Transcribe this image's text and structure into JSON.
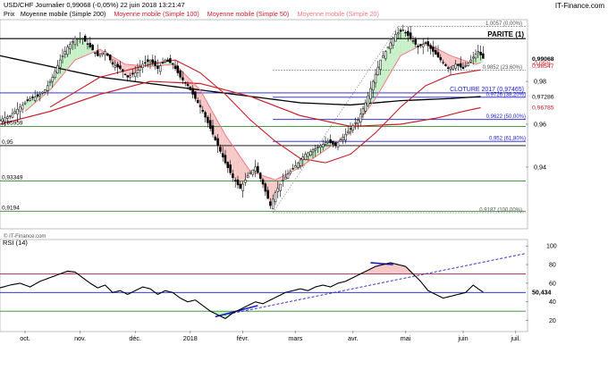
{
  "header": {
    "title": "USD/CHF   Journalier   0,99068 (-0,05%)   22 juin 2018 13:21:47",
    "brand": "IT-Finance.com"
  },
  "legend": [
    {
      "label": "Prix",
      "color": "#000000"
    },
    {
      "label": "Moyenne mobile (Simple 200)",
      "color": "#000000"
    },
    {
      "label": "Moyenne mobile (Simple 100)",
      "color": "#c81e28"
    },
    {
      "label": "Moyenne mobile (Simple 50)",
      "color": "#c81e28"
    },
    {
      "label": "Moyenne mobile (Simple 20)",
      "color": "#f07a84"
    }
  ],
  "watermark": "© IT-Finance.com",
  "colors": {
    "candle": "#000000",
    "sma200": "#000000",
    "sma100": "#c81e28",
    "sma50": "#c81e28",
    "sma20": "#f07a84",
    "horizontal": "#000000",
    "support_green": "#2e8b2e",
    "fib_blue": "#1a1acc",
    "rsi_line": "#000000",
    "rsi_upper": "#b0204a",
    "rsi_mid": "#1a1acc",
    "rsi_lower": "#2e8b2e",
    "fill_green": "#c8f0c8",
    "fill_red": "#f6c8c8",
    "trend_blue": "#1a1acc"
  },
  "chart_data": [
    {
      "type": "candlestick",
      "name": "USD/CHF Journalier",
      "ylim": [
        0.912,
        1.008
      ],
      "xlim": [
        0,
        210
      ],
      "x_ticks": [
        {
          "x": 10,
          "label": "oct."
        },
        {
          "x": 32,
          "label": "nov."
        },
        {
          "x": 54,
          "label": "déc."
        },
        {
          "x": 76,
          "label": "2018"
        },
        {
          "x": 97,
          "label": "févr."
        },
        {
          "x": 118,
          "label": "mars"
        },
        {
          "x": 141,
          "label": "avr."
        },
        {
          "x": 162,
          "label": "mai"
        },
        {
          "x": 185,
          "label": "juin"
        },
        {
          "x": 206,
          "label": "juil."
        }
      ],
      "y_ticks": [
        0.94,
        0.96,
        0.98
      ],
      "price_path": [
        [
          0,
          0.962
        ],
        [
          4,
          0.964
        ],
        [
          8,
          0.968
        ],
        [
          12,
          0.972
        ],
        [
          15,
          0.973
        ],
        [
          18,
          0.976
        ],
        [
          21,
          0.982
        ],
        [
          24,
          0.99
        ],
        [
          27,
          0.996
        ],
        [
          30,
          1.0
        ],
        [
          33,
          1.0
        ],
        [
          36,
          0.996
        ],
        [
          39,
          0.992
        ],
        [
          42,
          0.994
        ],
        [
          45,
          0.988
        ],
        [
          48,
          0.986
        ],
        [
          51,
          0.982
        ],
        [
          54,
          0.984
        ],
        [
          57,
          0.988
        ],
        [
          60,
          0.99
        ],
        [
          63,
          0.986
        ],
        [
          66,
          0.99
        ],
        [
          69,
          0.988
        ],
        [
          72,
          0.982
        ],
        [
          75,
          0.978
        ],
        [
          78,
          0.972
        ],
        [
          81,
          0.966
        ],
        [
          84,
          0.958
        ],
        [
          87,
          0.95
        ],
        [
          90,
          0.942
        ],
        [
          93,
          0.935
        ],
        [
          96,
          0.93
        ],
        [
          99,
          0.936
        ],
        [
          102,
          0.94
        ],
        [
          105,
          0.932
        ],
        [
          108,
          0.922
        ],
        [
          110,
          0.928
        ],
        [
          113,
          0.934
        ],
        [
          116,
          0.938
        ],
        [
          119,
          0.942
        ],
        [
          122,
          0.946
        ],
        [
          125,
          0.948
        ],
        [
          128,
          0.95
        ],
        [
          131,
          0.952
        ],
        [
          134,
          0.95
        ],
        [
          137,
          0.954
        ],
        [
          140,
          0.958
        ],
        [
          143,
          0.962
        ],
        [
          146,
          0.97
        ],
        [
          149,
          0.98
        ],
        [
          152,
          0.99
        ],
        [
          155,
          0.996
        ],
        [
          158,
          1.002
        ],
        [
          161,
          1.004
        ],
        [
          164,
          1.0
        ],
        [
          167,
          0.996
        ],
        [
          170,
          0.998
        ],
        [
          173,
          0.994
        ],
        [
          176,
          0.99
        ],
        [
          179,
          0.986
        ],
        [
          182,
          0.988
        ],
        [
          185,
          0.986
        ],
        [
          188,
          0.99
        ],
        [
          191,
          0.994
        ],
        [
          193,
          0.9907
        ]
      ],
      "sma20": [
        [
          10,
          0.966
        ],
        [
          20,
          0.976
        ],
        [
          30,
          0.99
        ],
        [
          40,
          0.995
        ],
        [
          50,
          0.988
        ],
        [
          60,
          0.987
        ],
        [
          70,
          0.988
        ],
        [
          80,
          0.976
        ],
        [
          90,
          0.955
        ],
        [
          100,
          0.938
        ],
        [
          110,
          0.934
        ],
        [
          120,
          0.94
        ],
        [
          130,
          0.948
        ],
        [
          140,
          0.956
        ],
        [
          150,
          0.972
        ],
        [
          160,
          0.992
        ],
        [
          170,
          0.998
        ],
        [
          180,
          0.992
        ],
        [
          190,
          0.988
        ],
        [
          193,
          0.989
        ]
      ],
      "sma50": [
        [
          20,
          0.968
        ],
        [
          40,
          0.982
        ],
        [
          60,
          0.988
        ],
        [
          70,
          0.99
        ],
        [
          80,
          0.984
        ],
        [
          90,
          0.974
        ],
        [
          100,
          0.962
        ],
        [
          110,
          0.952
        ],
        [
          120,
          0.944
        ],
        [
          130,
          0.942
        ],
        [
          140,
          0.946
        ],
        [
          150,
          0.956
        ],
        [
          160,
          0.968
        ],
        [
          170,
          0.978
        ],
        [
          180,
          0.983
        ],
        [
          190,
          0.985
        ],
        [
          193,
          0.9855
        ]
      ],
      "sma100": [
        [
          0,
          0.96
        ],
        [
          20,
          0.966
        ],
        [
          40,
          0.974
        ],
        [
          60,
          0.98
        ],
        [
          80,
          0.979
        ],
        [
          100,
          0.973
        ],
        [
          120,
          0.964
        ],
        [
          140,
          0.959
        ],
        [
          160,
          0.96
        ],
        [
          175,
          0.963
        ],
        [
          185,
          0.966
        ],
        [
          193,
          0.968
        ]
      ],
      "sma200": [
        [
          0,
          0.992
        ],
        [
          20,
          0.987
        ],
        [
          40,
          0.982
        ],
        [
          60,
          0.979
        ],
        [
          80,
          0.976
        ],
        [
          100,
          0.973
        ],
        [
          120,
          0.97
        ],
        [
          140,
          0.969
        ],
        [
          160,
          0.971
        ],
        [
          180,
          0.972
        ],
        [
          193,
          0.973
        ]
      ],
      "horizontal_levels": [
        {
          "value": 1.0,
          "label": "PARITE (1)",
          "color": "horizontal",
          "x_from": 0,
          "x_to": 210
        },
        {
          "value": 0.97465,
          "label": "CLOTURE 2017 (0,97465)",
          "color": "fib_blue",
          "x_from": 0,
          "x_to": 210
        },
        {
          "value": 0.9622,
          "label": "0,9622 (50,00%)",
          "color": "fib_blue",
          "x_from": 109,
          "x_to": 210
        },
        {
          "value": 0.95,
          "label": "0,95",
          "color": "horizontal",
          "x_from": 0,
          "x_to": 210
        },
        {
          "value": 0.952,
          "label": "0,952 (61,80%)",
          "color": "fib_blue",
          "x_from": 109,
          "x_to": 210
        },
        {
          "value": 0.9726,
          "label": "0,9726 (38,20%)",
          "color": "fib_blue",
          "x_from": 109,
          "x_to": 210
        },
        {
          "value": 0.959,
          "label": "0,95959",
          "color": "support_green",
          "x_from": 0,
          "x_to": 210
        },
        {
          "value": 0.93349,
          "label": "0,93349",
          "color": "support_green",
          "x_from": 0,
          "x_to": 210
        },
        {
          "value": 0.9194,
          "label": "0,9194",
          "color": "support_green",
          "x_from": 0,
          "x_to": 210
        }
      ],
      "dotted_levels": [
        {
          "value": 1.0057,
          "label": "1,0057 (0,00%)",
          "x_from": 159,
          "x_to": 210
        },
        {
          "value": 0.9852,
          "label": "0,9852 (23,60%)",
          "x_from": 109,
          "x_to": 210
        },
        {
          "value": 0.9187,
          "label": "0,9187 (100,00%)",
          "x_from": 109,
          "x_to": 210
        }
      ],
      "price_tags": [
        {
          "value": 0.99068,
          "label": "0,99068",
          "color": "#000000"
        },
        {
          "value": 0.9886,
          "label": "-0,05%",
          "color": "#c81e28"
        },
        {
          "value": 0.9874,
          "label": "0,98547",
          "color": "#c81e28"
        },
        {
          "value": 0.97286,
          "label": "0,97286",
          "color": "#000000"
        },
        {
          "value": 0.96785,
          "label": "0,96785",
          "color": "#c81e28"
        }
      ]
    },
    {
      "type": "line",
      "name": "RSI (14)",
      "ylim": [
        10,
        105
      ],
      "y_ticks": [
        20,
        40,
        60,
        80,
        100
      ],
      "levels": [
        {
          "value": 70,
          "color": "rsi_upper"
        },
        {
          "value": 50,
          "color": "rsi_mid"
        },
        {
          "value": 30,
          "color": "rsi_lower"
        }
      ],
      "last_value_label": "50,434",
      "last_value": 50.434,
      "values": [
        [
          0,
          55
        ],
        [
          4,
          58
        ],
        [
          8,
          60
        ],
        [
          12,
          56
        ],
        [
          16,
          62
        ],
        [
          20,
          66
        ],
        [
          24,
          70
        ],
        [
          27,
          73
        ],
        [
          30,
          72
        ],
        [
          33,
          66
        ],
        [
          36,
          60
        ],
        [
          39,
          55
        ],
        [
          42,
          58
        ],
        [
          45,
          50
        ],
        [
          48,
          52
        ],
        [
          51,
          48
        ],
        [
          54,
          52
        ],
        [
          57,
          56
        ],
        [
          60,
          54
        ],
        [
          63,
          48
        ],
        [
          66,
          52
        ],
        [
          69,
          50
        ],
        [
          72,
          44
        ],
        [
          75,
          40
        ],
        [
          78,
          42
        ],
        [
          81,
          36
        ],
        [
          84,
          30
        ],
        [
          87,
          26
        ],
        [
          90,
          22
        ],
        [
          93,
          28
        ],
        [
          96,
          32
        ],
        [
          99,
          36
        ],
        [
          102,
          40
        ],
        [
          105,
          38
        ],
        [
          108,
          42
        ],
        [
          111,
          46
        ],
        [
          114,
          50
        ],
        [
          117,
          52
        ],
        [
          120,
          54
        ],
        [
          123,
          52
        ],
        [
          126,
          56
        ],
        [
          129,
          58
        ],
        [
          132,
          56
        ],
        [
          135,
          60
        ],
        [
          138,
          62
        ],
        [
          141,
          66
        ],
        [
          144,
          70
        ],
        [
          147,
          74
        ],
        [
          150,
          78
        ],
        [
          153,
          80
        ],
        [
          156,
          82
        ],
        [
          159,
          80
        ],
        [
          162,
          78
        ],
        [
          165,
          70
        ],
        [
          168,
          62
        ],
        [
          171,
          52
        ],
        [
          174,
          48
        ],
        [
          177,
          44
        ],
        [
          180,
          46
        ],
        [
          183,
          48
        ],
        [
          186,
          50
        ],
        [
          189,
          58
        ],
        [
          191,
          54
        ],
        [
          193,
          50.434
        ]
      ]
    }
  ]
}
